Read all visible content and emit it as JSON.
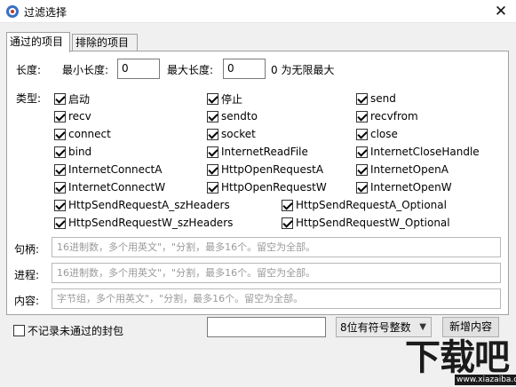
{
  "window": {
    "title": "过滤选择",
    "close_glyph": "✕",
    "app_icon": "app-icon"
  },
  "tabs": [
    {
      "label": "通过的项目",
      "active": true
    },
    {
      "label": "排除的项目",
      "active": false
    }
  ],
  "length": {
    "label": "长度:",
    "min_label": "最小长度:",
    "min_value": "0",
    "max_label": "最大长度:",
    "max_value": "0",
    "note": "0 为无限最大"
  },
  "types": {
    "label": "类型:",
    "items": [
      {
        "label": "启动",
        "checked": true
      },
      {
        "label": "停止",
        "checked": true
      },
      {
        "label": "send",
        "checked": true
      },
      {
        "label": "recv",
        "checked": true
      },
      {
        "label": "sendto",
        "checked": true
      },
      {
        "label": "recvfrom",
        "checked": true
      },
      {
        "label": "connect",
        "checked": true
      },
      {
        "label": "socket",
        "checked": true
      },
      {
        "label": "close",
        "checked": true
      },
      {
        "label": "bind",
        "checked": true
      },
      {
        "label": "InternetReadFile",
        "checked": true
      },
      {
        "label": "InternetCloseHandle",
        "checked": true
      },
      {
        "label": "InternetConnectA",
        "checked": true
      },
      {
        "label": "HttpOpenRequestA",
        "checked": true
      },
      {
        "label": "InternetOpenA",
        "checked": true
      },
      {
        "label": "InternetConnectW",
        "checked": true
      },
      {
        "label": "HttpOpenRequestW",
        "checked": true
      },
      {
        "label": "InternetOpenW",
        "checked": true
      },
      {
        "label": "HttpSendRequestA_szHeaders",
        "checked": true
      },
      {
        "label": "HttpSendRequestA_Optional",
        "checked": true
      },
      {
        "label": "HttpSendRequestW_szHeaders",
        "checked": true
      },
      {
        "label": "HttpSendRequestW_Optional",
        "checked": true
      }
    ]
  },
  "handle": {
    "label": "句柄:",
    "placeholder": "16进制数，多个用英文\"，\"分割，最多16个。留空为全部。"
  },
  "process": {
    "label": "进程:",
    "placeholder": "16进制数，多个用英文\"，\"分割，最多16个。留空为全部。"
  },
  "content": {
    "label": "内容:",
    "placeholder": "字节组，多个用英文\"，\"分割，最多16个。留空为全部。"
  },
  "bottom": {
    "no_record_label": "不记录未通过的封包",
    "no_record_checked": false,
    "input_value": "",
    "select_value": "8位有符号整数",
    "add_button": "新增内容"
  },
  "watermark": {
    "text": "下载吧",
    "url": "www.xiazaiba.com"
  }
}
